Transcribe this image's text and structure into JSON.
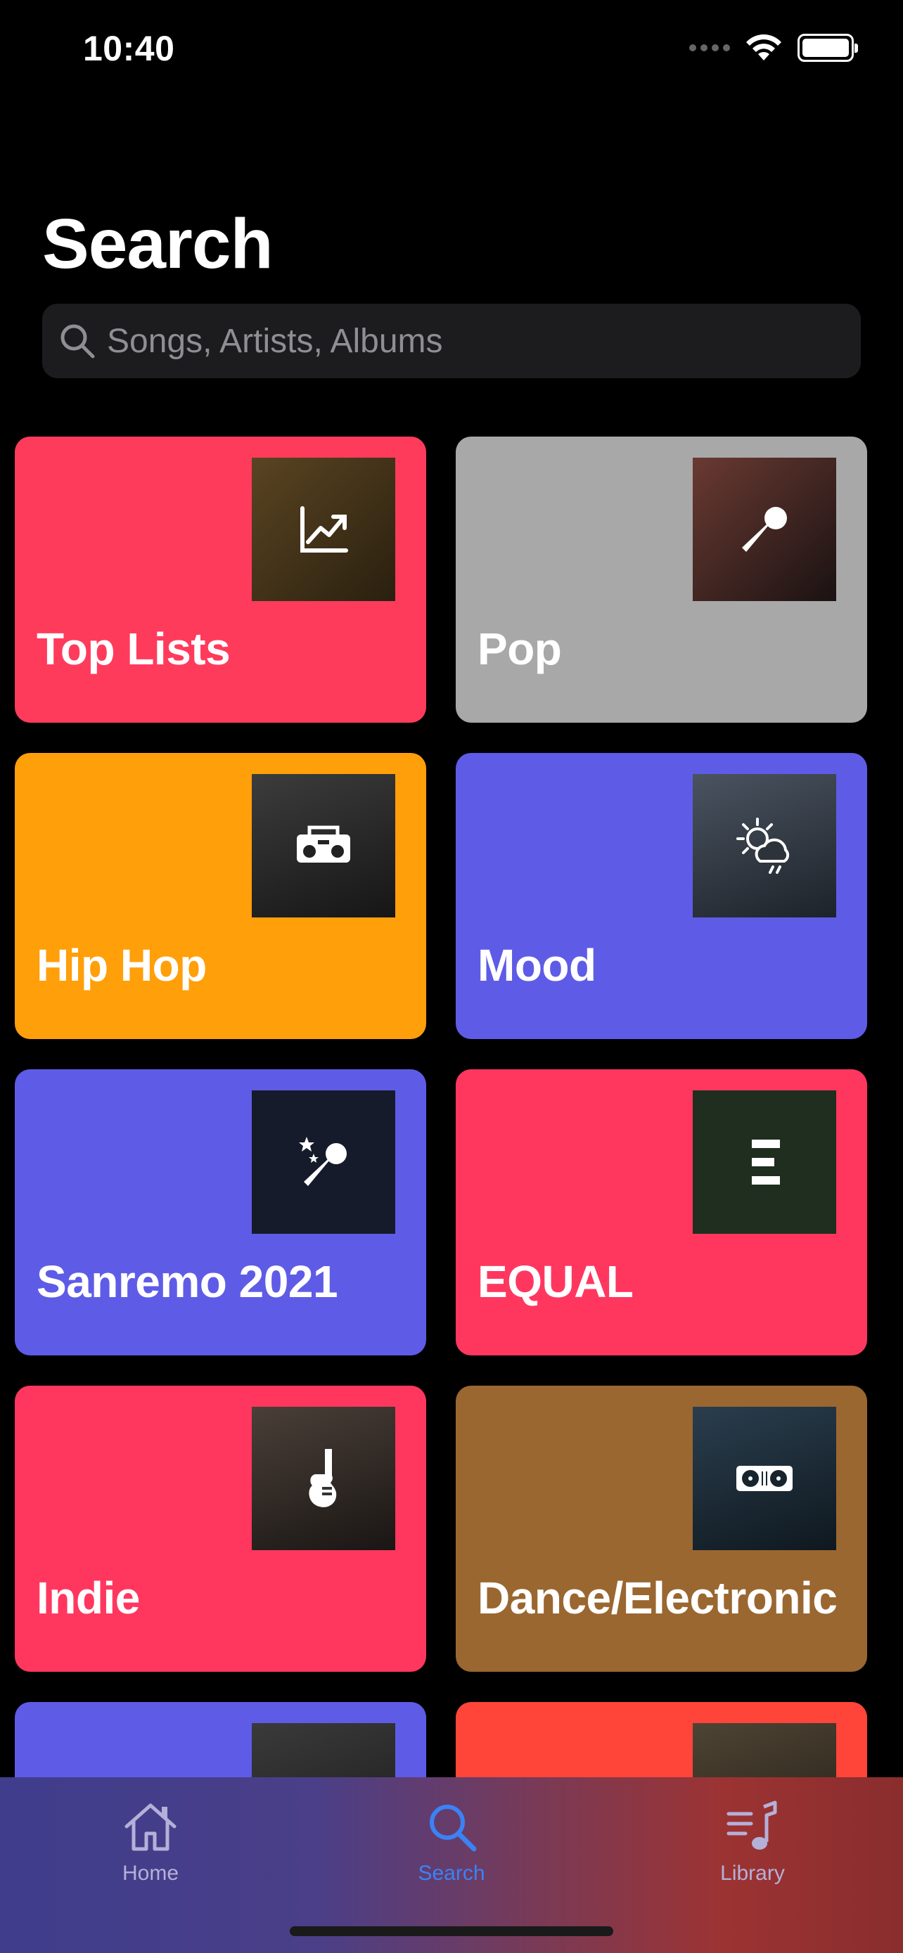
{
  "status_bar": {
    "time": "10:40"
  },
  "header": {
    "title": "Search"
  },
  "search": {
    "placeholder": "Songs, Artists, Albums",
    "value": ""
  },
  "categories": [
    {
      "label": "Top Lists",
      "color": "#ff3b5c",
      "icon": "chart-icon",
      "art_bg": "#3a2c14"
    },
    {
      "label": "Pop",
      "color": "#a8a8a8",
      "icon": "microphone-icon",
      "art_bg": "#2a1a1a"
    },
    {
      "label": "Hip Hop",
      "color": "#ff9f0a",
      "icon": "boombox-icon",
      "art_bg": "#2a2a2a"
    },
    {
      "label": "Mood",
      "color": "#5e5ce6",
      "icon": "weather-icon",
      "art_bg": "#2c333b"
    },
    {
      "label": "Sanremo 2021",
      "color": "#5e5ce6",
      "icon": "star-microphone-icon",
      "art_bg": "#161b2b"
    },
    {
      "label": "EQUAL",
      "color": "#ff375f",
      "icon": "equal-logo-icon",
      "art_bg": "#1f2e1e"
    },
    {
      "label": "Indie",
      "color": "#ff375f",
      "icon": "guitar-icon",
      "art_bg": "#2a2522"
    },
    {
      "label": "Dance/Electronic",
      "color": "#9a6731",
      "icon": "turntable-icon",
      "art_bg": "#17242e"
    },
    {
      "label": "",
      "color": "#5e5ce6",
      "icon": "photo-icon",
      "art_bg": "#2a2a2a"
    },
    {
      "label": "",
      "color": "#ff453a",
      "icon": "amplifier-icon",
      "art_bg": "#3a3226"
    }
  ],
  "tab_bar": {
    "tabs": [
      {
        "label": "Home",
        "icon": "home-icon",
        "active": false
      },
      {
        "label": "Search",
        "icon": "search-icon",
        "active": true
      },
      {
        "label": "Library",
        "icon": "library-icon",
        "active": false
      }
    ]
  }
}
